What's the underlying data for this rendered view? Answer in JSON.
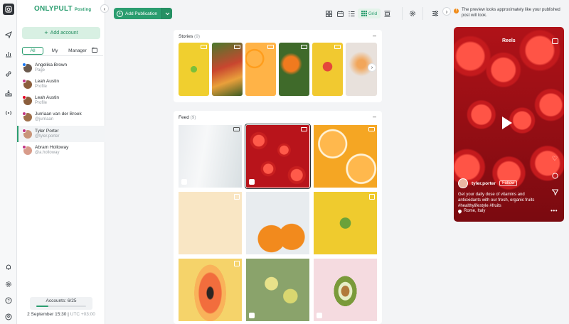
{
  "app": {
    "brand": "ONLYPULT",
    "brand_sub": "Posting"
  },
  "sidebar": {
    "add_account_label": "Add account",
    "tabs": [
      "All",
      "My",
      "Manager"
    ],
    "active_tab": "All",
    "accounts": [
      {
        "name": "Angelika Brown",
        "subtitle": "Page",
        "selected": false
      },
      {
        "name": "Leah Austin",
        "subtitle": "Profile",
        "selected": false
      },
      {
        "name": "Leah Austin",
        "subtitle": "Profile",
        "selected": false
      },
      {
        "name": "Jurriaan van der Broek",
        "subtitle": "@jurriaan",
        "selected": false
      },
      {
        "name": "Tyler Porter",
        "subtitle": "@tyler.porter",
        "selected": true
      },
      {
        "name": "Abram Holloway",
        "subtitle": "@a.holloway",
        "selected": false
      }
    ],
    "accounts_counter": "Accounts: 6/25",
    "accounts_used": 6,
    "accounts_total": 25,
    "datetime": "2 September 15:30",
    "timezone": "UTC +03:00"
  },
  "toolbar": {
    "add_publication_label": "Add Publication",
    "grid_label": "Grid"
  },
  "stories": {
    "title": "Stories",
    "count": "(9)"
  },
  "feed": {
    "title": "Feed",
    "count": "(9)"
  },
  "preview": {
    "notice": "The preview looks approximately like your published post will look.",
    "reels_label": "Reels",
    "username": "tyler.porter",
    "follow_label": "Follow",
    "caption": "Get your daily dose of vitamins and antioxidants with our fresh, organic fruits #healthylifestyle #fruits",
    "location": "Rome, Italy"
  },
  "colors": {
    "accent": "#2a9d6f",
    "accent_light": "#d8f0e3",
    "instagram_badge": "#c13584",
    "notice_icon": "#f08c1a"
  }
}
